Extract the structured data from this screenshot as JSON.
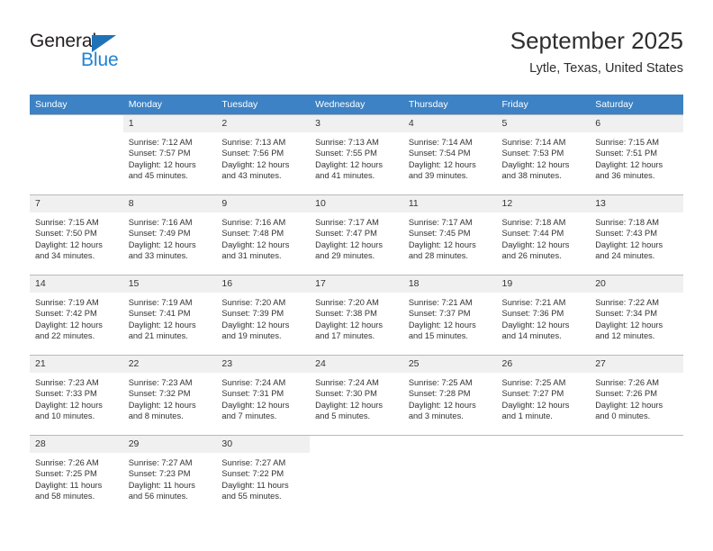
{
  "brand": {
    "name_top": "General",
    "name_bottom": "Blue",
    "accent_color": "#1f83d6",
    "triangle_color": "#1f72b8"
  },
  "header": {
    "title": "September 2025",
    "subtitle": "Lytle, Texas, United States"
  },
  "theme": {
    "header_row_bg": "#3c82c4",
    "header_row_text": "#ffffff",
    "daynum_bg": "#f0f0f0",
    "grid_line": "#b9b9b9",
    "body_text": "#333333"
  },
  "weekday_headers": [
    "Sunday",
    "Monday",
    "Tuesday",
    "Wednesday",
    "Thursday",
    "Friday",
    "Saturday"
  ],
  "calendar_data": {
    "month": "September",
    "year": 2025,
    "location": "Lytle, Texas, United States",
    "first_weekday_index": 1,
    "days_in_month": 30,
    "weeks": [
      [
        {
          "day": "",
          "sunrise": "",
          "sunset": "",
          "daylight": "",
          "empty": true
        },
        {
          "day": "1",
          "sunrise": "Sunrise: 7:12 AM",
          "sunset": "Sunset: 7:57 PM",
          "daylight": "Daylight: 12 hours and 45 minutes."
        },
        {
          "day": "2",
          "sunrise": "Sunrise: 7:13 AM",
          "sunset": "Sunset: 7:56 PM",
          "daylight": "Daylight: 12 hours and 43 minutes."
        },
        {
          "day": "3",
          "sunrise": "Sunrise: 7:13 AM",
          "sunset": "Sunset: 7:55 PM",
          "daylight": "Daylight: 12 hours and 41 minutes."
        },
        {
          "day": "4",
          "sunrise": "Sunrise: 7:14 AM",
          "sunset": "Sunset: 7:54 PM",
          "daylight": "Daylight: 12 hours and 39 minutes."
        },
        {
          "day": "5",
          "sunrise": "Sunrise: 7:14 AM",
          "sunset": "Sunset: 7:53 PM",
          "daylight": "Daylight: 12 hours and 38 minutes."
        },
        {
          "day": "6",
          "sunrise": "Sunrise: 7:15 AM",
          "sunset": "Sunset: 7:51 PM",
          "daylight": "Daylight: 12 hours and 36 minutes."
        }
      ],
      [
        {
          "day": "7",
          "sunrise": "Sunrise: 7:15 AM",
          "sunset": "Sunset: 7:50 PM",
          "daylight": "Daylight: 12 hours and 34 minutes."
        },
        {
          "day": "8",
          "sunrise": "Sunrise: 7:16 AM",
          "sunset": "Sunset: 7:49 PM",
          "daylight": "Daylight: 12 hours and 33 minutes."
        },
        {
          "day": "9",
          "sunrise": "Sunrise: 7:16 AM",
          "sunset": "Sunset: 7:48 PM",
          "daylight": "Daylight: 12 hours and 31 minutes."
        },
        {
          "day": "10",
          "sunrise": "Sunrise: 7:17 AM",
          "sunset": "Sunset: 7:47 PM",
          "daylight": "Daylight: 12 hours and 29 minutes."
        },
        {
          "day": "11",
          "sunrise": "Sunrise: 7:17 AM",
          "sunset": "Sunset: 7:45 PM",
          "daylight": "Daylight: 12 hours and 28 minutes."
        },
        {
          "day": "12",
          "sunrise": "Sunrise: 7:18 AM",
          "sunset": "Sunset: 7:44 PM",
          "daylight": "Daylight: 12 hours and 26 minutes."
        },
        {
          "day": "13",
          "sunrise": "Sunrise: 7:18 AM",
          "sunset": "Sunset: 7:43 PM",
          "daylight": "Daylight: 12 hours and 24 minutes."
        }
      ],
      [
        {
          "day": "14",
          "sunrise": "Sunrise: 7:19 AM",
          "sunset": "Sunset: 7:42 PM",
          "daylight": "Daylight: 12 hours and 22 minutes."
        },
        {
          "day": "15",
          "sunrise": "Sunrise: 7:19 AM",
          "sunset": "Sunset: 7:41 PM",
          "daylight": "Daylight: 12 hours and 21 minutes."
        },
        {
          "day": "16",
          "sunrise": "Sunrise: 7:20 AM",
          "sunset": "Sunset: 7:39 PM",
          "daylight": "Daylight: 12 hours and 19 minutes."
        },
        {
          "day": "17",
          "sunrise": "Sunrise: 7:20 AM",
          "sunset": "Sunset: 7:38 PM",
          "daylight": "Daylight: 12 hours and 17 minutes."
        },
        {
          "day": "18",
          "sunrise": "Sunrise: 7:21 AM",
          "sunset": "Sunset: 7:37 PM",
          "daylight": "Daylight: 12 hours and 15 minutes."
        },
        {
          "day": "19",
          "sunrise": "Sunrise: 7:21 AM",
          "sunset": "Sunset: 7:36 PM",
          "daylight": "Daylight: 12 hours and 14 minutes."
        },
        {
          "day": "20",
          "sunrise": "Sunrise: 7:22 AM",
          "sunset": "Sunset: 7:34 PM",
          "daylight": "Daylight: 12 hours and 12 minutes."
        }
      ],
      [
        {
          "day": "21",
          "sunrise": "Sunrise: 7:23 AM",
          "sunset": "Sunset: 7:33 PM",
          "daylight": "Daylight: 12 hours and 10 minutes."
        },
        {
          "day": "22",
          "sunrise": "Sunrise: 7:23 AM",
          "sunset": "Sunset: 7:32 PM",
          "daylight": "Daylight: 12 hours and 8 minutes."
        },
        {
          "day": "23",
          "sunrise": "Sunrise: 7:24 AM",
          "sunset": "Sunset: 7:31 PM",
          "daylight": "Daylight: 12 hours and 7 minutes."
        },
        {
          "day": "24",
          "sunrise": "Sunrise: 7:24 AM",
          "sunset": "Sunset: 7:30 PM",
          "daylight": "Daylight: 12 hours and 5 minutes."
        },
        {
          "day": "25",
          "sunrise": "Sunrise: 7:25 AM",
          "sunset": "Sunset: 7:28 PM",
          "daylight": "Daylight: 12 hours and 3 minutes."
        },
        {
          "day": "26",
          "sunrise": "Sunrise: 7:25 AM",
          "sunset": "Sunset: 7:27 PM",
          "daylight": "Daylight: 12 hours and 1 minute."
        },
        {
          "day": "27",
          "sunrise": "Sunrise: 7:26 AM",
          "sunset": "Sunset: 7:26 PM",
          "daylight": "Daylight: 12 hours and 0 minutes."
        }
      ],
      [
        {
          "day": "28",
          "sunrise": "Sunrise: 7:26 AM",
          "sunset": "Sunset: 7:25 PM",
          "daylight": "Daylight: 11 hours and 58 minutes."
        },
        {
          "day": "29",
          "sunrise": "Sunrise: 7:27 AM",
          "sunset": "Sunset: 7:23 PM",
          "daylight": "Daylight: 11 hours and 56 minutes."
        },
        {
          "day": "30",
          "sunrise": "Sunrise: 7:27 AM",
          "sunset": "Sunset: 7:22 PM",
          "daylight": "Daylight: 11 hours and 55 minutes."
        },
        {
          "day": "",
          "sunrise": "",
          "sunset": "",
          "daylight": "",
          "empty": true
        },
        {
          "day": "",
          "sunrise": "",
          "sunset": "",
          "daylight": "",
          "empty": true
        },
        {
          "day": "",
          "sunrise": "",
          "sunset": "",
          "daylight": "",
          "empty": true
        },
        {
          "day": "",
          "sunrise": "",
          "sunset": "",
          "daylight": "",
          "empty": true
        }
      ]
    ]
  }
}
